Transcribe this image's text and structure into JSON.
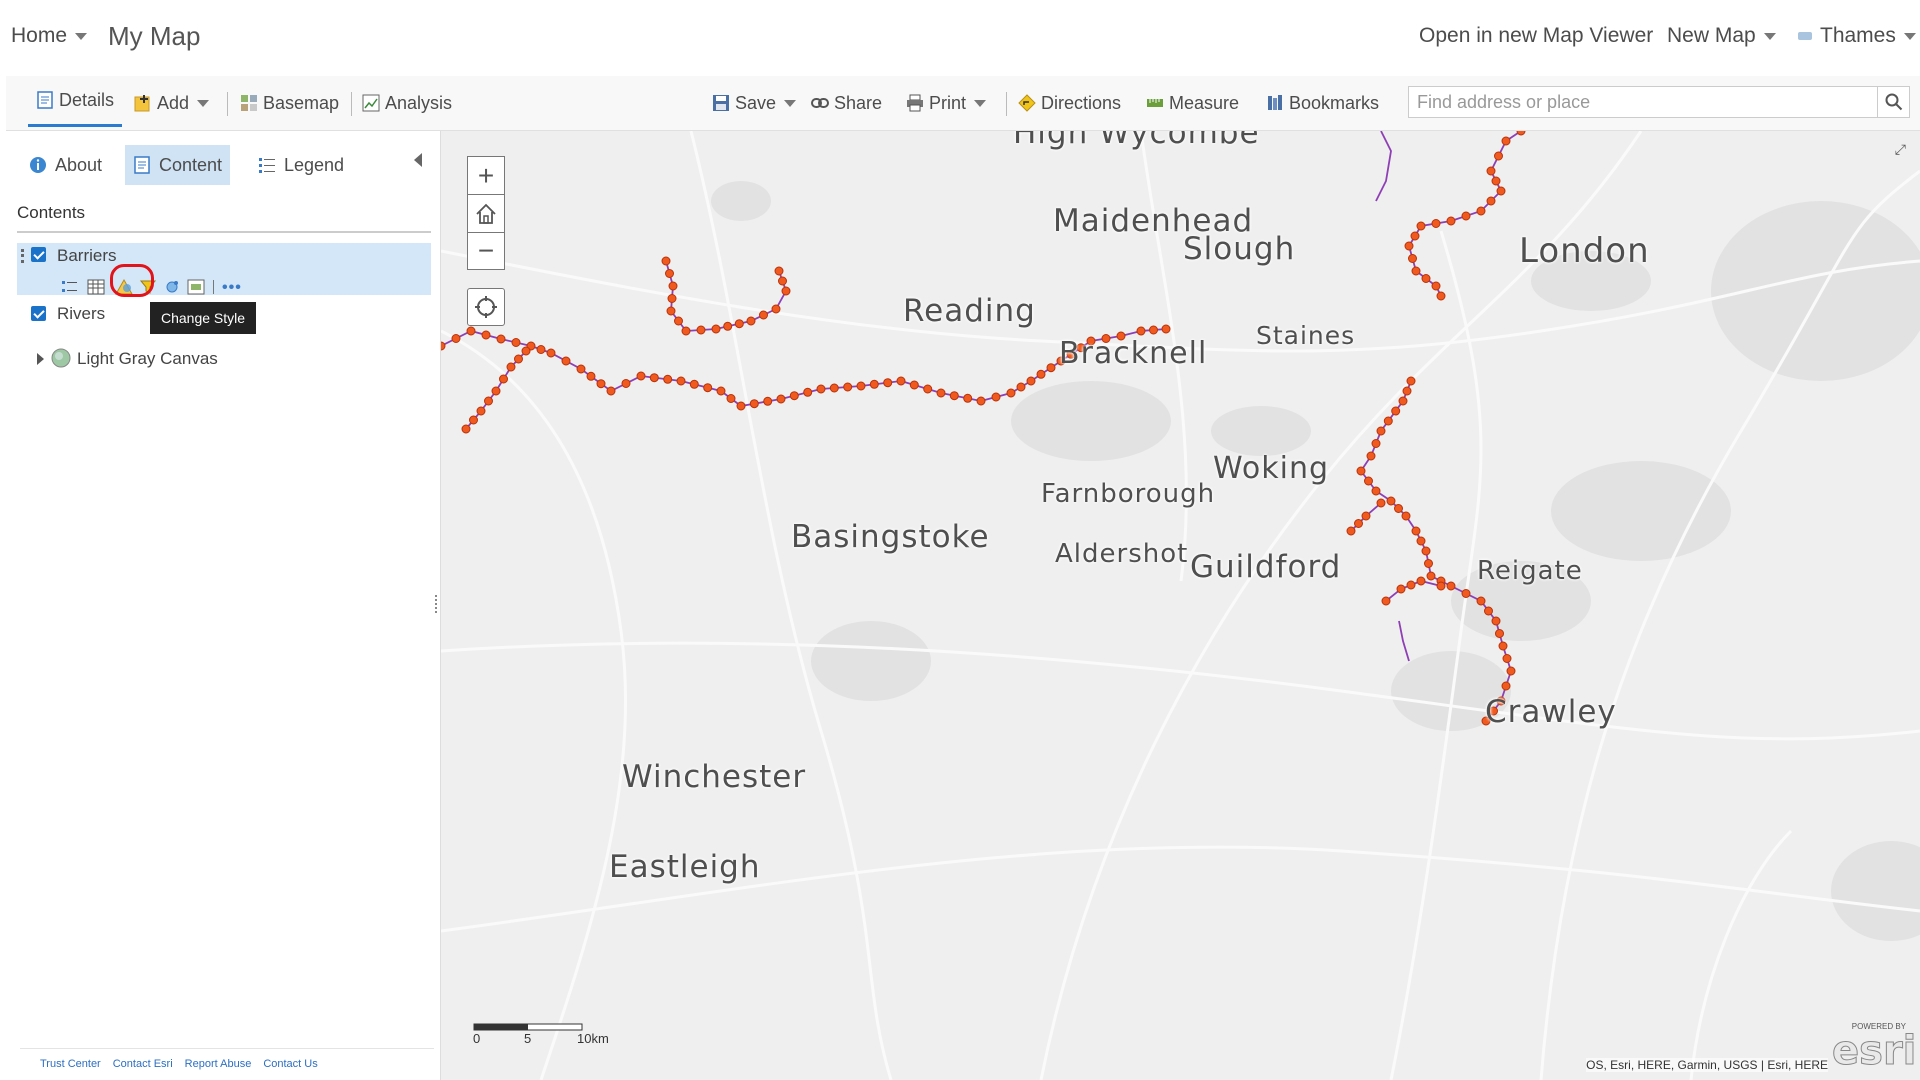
{
  "header": {
    "home_label": "Home",
    "map_title": "My Map",
    "open_new_viewer": "Open in new Map Viewer",
    "new_map_label": "New Map",
    "user_label": "Thames"
  },
  "toolbar": {
    "details": "Details",
    "add": "Add",
    "basemap": "Basemap",
    "analysis": "Analysis",
    "save": "Save",
    "share": "Share",
    "print": "Print",
    "directions": "Directions",
    "measure": "Measure",
    "bookmarks": "Bookmarks",
    "search_placeholder": "Find address or place"
  },
  "panel": {
    "tabs": {
      "about": "About",
      "content": "Content",
      "legend": "Legend"
    },
    "contents_title": "Contents",
    "layers": [
      {
        "name": "Barriers",
        "checked": true
      },
      {
        "name": "Rivers",
        "checked": true
      },
      {
        "name": "Light Gray Canvas"
      }
    ],
    "tooltip": "Change Style",
    "footer_links": [
      "Trust Center",
      "Contact Esri",
      "Report Abuse",
      "Contact Us"
    ]
  },
  "map": {
    "cities": {
      "high_wycombe": "High Wycombe",
      "maidenhead": "Maidenhead",
      "slough": "Slough",
      "london": "London",
      "reading": "Reading",
      "staines": "Staines",
      "bracknell": "Bracknell",
      "woking": "Woking",
      "farnborough": "Farnborough",
      "basingstoke": "Basingstoke",
      "aldershot": "Aldershot",
      "guildford": "Guildford",
      "reigate": "Reigate",
      "crawley": "Crawley",
      "winchester": "Winchester",
      "eastleigh": "Eastleigh"
    },
    "scale": {
      "l0": "0",
      "l5": "5",
      "l10": "10km"
    },
    "attribution": "OS, Esri, HERE, Garmin, USGS | Esri, HERE",
    "logo_small": "POWERED BY",
    "logo_text": "esri",
    "river_color": "#8e3fb5",
    "barrier_color": "#f05a1e"
  }
}
